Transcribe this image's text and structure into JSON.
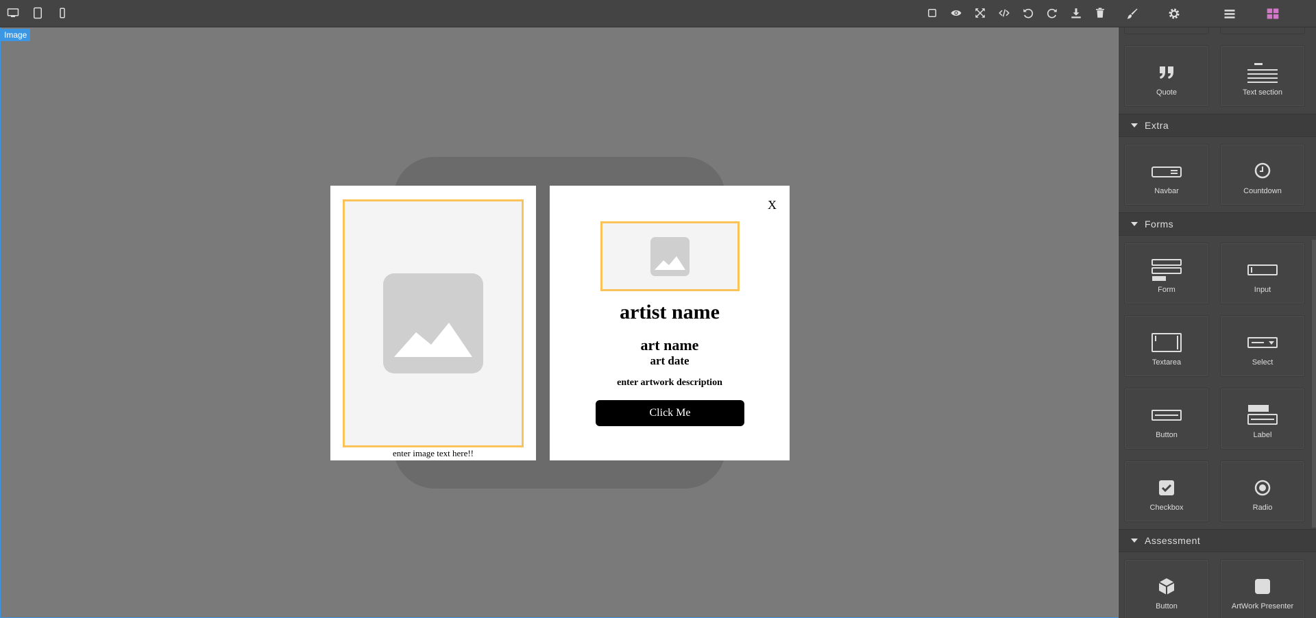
{
  "toolbar": {
    "devices": [
      "desktop-icon",
      "tablet-icon",
      "mobile-icon"
    ],
    "actions": [
      "square-icon",
      "eye-icon",
      "fullscreen-icon",
      "code-icon",
      "undo-icon",
      "redo-icon",
      "download-icon",
      "trash-icon"
    ],
    "panels": [
      "brush-icon",
      "gear-icon",
      "layers-icon",
      "blocks-icon"
    ]
  },
  "canvas": {
    "badge": "Image",
    "left_card": {
      "caption": "enter image text here!!"
    },
    "right_card": {
      "close": "X",
      "artist": "artist name",
      "art_name": "art name",
      "art_date": "art date",
      "description": "enter artwork description",
      "button": "Click Me"
    }
  },
  "sidebar": {
    "top_blocks": [
      "Quote",
      "Text section"
    ],
    "categories": [
      {
        "name": "Extra",
        "blocks": [
          "Navbar",
          "Countdown"
        ]
      },
      {
        "name": "Forms",
        "blocks": [
          "Form",
          "Input",
          "Textarea",
          "Select",
          "Button",
          "Label",
          "Checkbox",
          "Radio"
        ]
      },
      {
        "name": "Assessment",
        "blocks": [
          "Button",
          "ArtWork Presenter"
        ]
      }
    ]
  },
  "colors": {
    "accent": "#3b97e3",
    "frame": "#f9c35a",
    "blocks_active": "#d278c9"
  }
}
